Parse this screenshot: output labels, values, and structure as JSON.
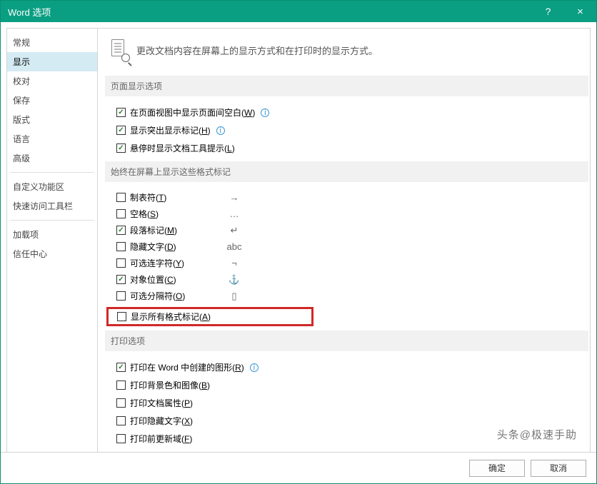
{
  "window": {
    "title": "Word 选项",
    "help": "?",
    "close": "×"
  },
  "sidebar": {
    "items": [
      {
        "label": "常规"
      },
      {
        "label": "显示",
        "active": true
      },
      {
        "label": "校对"
      },
      {
        "label": "保存"
      },
      {
        "label": "版式"
      },
      {
        "label": "语言"
      },
      {
        "label": "高级"
      }
    ],
    "items2": [
      {
        "label": "自定义功能区"
      },
      {
        "label": "快速访问工具栏"
      }
    ],
    "items3": [
      {
        "label": "加载项"
      },
      {
        "label": "信任中心"
      }
    ]
  },
  "header": {
    "text": "更改文档内容在屏幕上的显示方式和在打印时的显示方式。"
  },
  "section1": {
    "title": "页面显示选项",
    "opts": [
      {
        "checked": true,
        "label": "在页面视图中显示页面间空白(",
        "key": "W",
        "tail": ")",
        "info": true
      },
      {
        "checked": true,
        "label": "显示突出显示标记(",
        "key": "H",
        "tail": ")",
        "info": true
      },
      {
        "checked": true,
        "label": "悬停时显示文档工具提示(",
        "key": "L",
        "tail": ")"
      }
    ]
  },
  "section2": {
    "title": "始终在屏幕上显示这些格式标记",
    "marks": [
      {
        "checked": false,
        "label": "制表符(",
        "key": "T",
        "tail": ")",
        "glyph": "→"
      },
      {
        "checked": false,
        "label": "空格(",
        "key": "S",
        "tail": ")",
        "glyph": "…"
      },
      {
        "checked": true,
        "label": "段落标记(",
        "key": "M",
        "tail": ")",
        "glyph": "↵"
      },
      {
        "checked": false,
        "label": "隐藏文字(",
        "key": "D",
        "tail": ")",
        "glyph": "abc"
      },
      {
        "checked": false,
        "label": "可选连字符(",
        "key": "Y",
        "tail": ")",
        "glyph": "¬"
      },
      {
        "checked": true,
        "label": "对象位置(",
        "key": "C",
        "tail": ")",
        "glyph": "⚓"
      },
      {
        "checked": false,
        "label": "可选分隔符(",
        "key": "O",
        "tail": ")",
        "glyph": "▯"
      }
    ],
    "highlight": {
      "checked": false,
      "label": "显示所有格式标记(",
      "key": "A",
      "tail": ")"
    }
  },
  "section3": {
    "title": "打印选项",
    "opts": [
      {
        "checked": true,
        "label": "打印在 Word 中创建的图形(",
        "key": "R",
        "tail": ")",
        "info": true
      },
      {
        "checked": false,
        "label": "打印背景色和图像(",
        "key": "B",
        "tail": ")"
      },
      {
        "checked": false,
        "label": "打印文档属性(",
        "key": "P",
        "tail": ")"
      },
      {
        "checked": false,
        "label": "打印隐藏文字(",
        "key": "X",
        "tail": ")"
      },
      {
        "checked": false,
        "label": "打印前更新域(",
        "key": "F",
        "tail": ")"
      }
    ]
  },
  "footer": {
    "ok": "确定",
    "cancel": "取消"
  },
  "watermark": "头条@极速手助"
}
